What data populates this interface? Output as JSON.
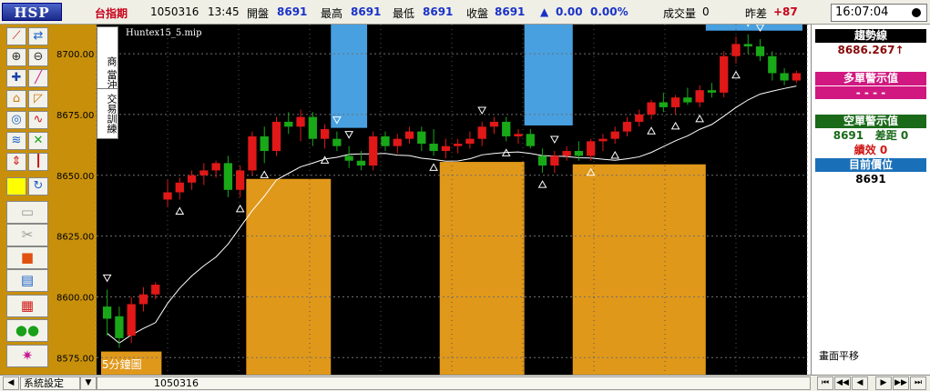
{
  "topbar": {
    "logo": "HSP",
    "symbol": "台指期",
    "date": "1050316",
    "time": "13:45",
    "open_label": "開盤",
    "open_value": "8691",
    "high_label": "最高",
    "high_value": "8691",
    "low_label": "最低",
    "low_value": "8691",
    "close_label": "收盤",
    "close_value": "8691",
    "change_arrow": "▲",
    "change_value": "0.00",
    "change_pct": "0.00%",
    "volume_label": "成交量",
    "volume_value": "0",
    "diff_label": "昨差",
    "diff_value": "+87",
    "clock": "16:07:04"
  },
  "chart": {
    "study_name": "Huntex15_5.mip",
    "vertical_label_1": "商",
    "vertical_label_2": "當沖狙擊",
    "vertical_label_3": "交易訓練",
    "interval_label": "5分鐘圖",
    "y_tick_labels": [
      "8700.00",
      "8675.00",
      "8650.00",
      "8625.00",
      "8600.00",
      "8575.00"
    ],
    "colors": {
      "up": "#e01818",
      "down": "#18a818",
      "fill_orange": "#e0981a",
      "fill_blue": "#48a0e0",
      "background": "#000000",
      "ma_line": "#ffffff"
    }
  },
  "chart_data": {
    "type": "candlestick",
    "ylim": [
      8568,
      8712
    ],
    "y_ticks": [
      8700,
      8675,
      8650,
      8625,
      8600,
      8575
    ],
    "candles": [
      {
        "o": 8596,
        "h": 8603,
        "l": 8584,
        "c": 8591
      },
      {
        "o": 8592,
        "h": 8596,
        "l": 8579,
        "c": 8583
      },
      {
        "o": 8584,
        "h": 8600,
        "l": 8581,
        "c": 8597
      },
      {
        "o": 8597,
        "h": 8604,
        "l": 8594,
        "c": 8601
      },
      {
        "o": 8601,
        "h": 8606,
        "l": 8599,
        "c": 8605
      },
      {
        "o": 8640,
        "h": 8648,
        "l": 8637,
        "c": 8643
      },
      {
        "o": 8643,
        "h": 8649,
        "l": 8640,
        "c": 8647
      },
      {
        "o": 8647,
        "h": 8652,
        "l": 8644,
        "c": 8650
      },
      {
        "o": 8650,
        "h": 8655,
        "l": 8646,
        "c": 8652
      },
      {
        "o": 8652,
        "h": 8656,
        "l": 8649,
        "c": 8655
      },
      {
        "o": 8655,
        "h": 8658,
        "l": 8641,
        "c": 8644
      },
      {
        "o": 8644,
        "h": 8654,
        "l": 8641,
        "c": 8652
      },
      {
        "o": 8652,
        "h": 8668,
        "l": 8650,
        "c": 8666
      },
      {
        "o": 8666,
        "h": 8670,
        "l": 8655,
        "c": 8660
      },
      {
        "o": 8660,
        "h": 8674,
        "l": 8658,
        "c": 8672
      },
      {
        "o": 8672,
        "h": 8676,
        "l": 8667,
        "c": 8670
      },
      {
        "o": 8670,
        "h": 8677,
        "l": 8664,
        "c": 8674
      },
      {
        "o": 8674,
        "h": 8676,
        "l": 8662,
        "c": 8665
      },
      {
        "o": 8665,
        "h": 8671,
        "l": 8661,
        "c": 8669
      },
      {
        "o": 8665,
        "h": 8668,
        "l": 8660,
        "c": 8662
      },
      {
        "o": 8658,
        "h": 8662,
        "l": 8653,
        "c": 8656
      },
      {
        "o": 8656,
        "h": 8660,
        "l": 8652,
        "c": 8654
      },
      {
        "o": 8654,
        "h": 8668,
        "l": 8652,
        "c": 8666
      },
      {
        "o": 8666,
        "h": 8668,
        "l": 8660,
        "c": 8662
      },
      {
        "o": 8662,
        "h": 8667,
        "l": 8659,
        "c": 8665
      },
      {
        "o": 8665,
        "h": 8670,
        "l": 8663,
        "c": 8668
      },
      {
        "o": 8668,
        "h": 8670,
        "l": 8660,
        "c": 8663
      },
      {
        "o": 8663,
        "h": 8669,
        "l": 8658,
        "c": 8660
      },
      {
        "o": 8660,
        "h": 8665,
        "l": 8657,
        "c": 8662
      },
      {
        "o": 8662,
        "h": 8665,
        "l": 8659,
        "c": 8663
      },
      {
        "o": 8663,
        "h": 8668,
        "l": 8661,
        "c": 8665
      },
      {
        "o": 8665,
        "h": 8672,
        "l": 8662,
        "c": 8670
      },
      {
        "o": 8670,
        "h": 8674,
        "l": 8667,
        "c": 8672
      },
      {
        "o": 8672,
        "h": 8674,
        "l": 8664,
        "c": 8666
      },
      {
        "o": 8666,
        "h": 8669,
        "l": 8663,
        "c": 8667
      },
      {
        "o": 8667,
        "h": 8669,
        "l": 8661,
        "c": 8662
      },
      {
        "o": 8658,
        "h": 8661,
        "l": 8651,
        "c": 8654
      },
      {
        "o": 8654,
        "h": 8660,
        "l": 8651,
        "c": 8658
      },
      {
        "o": 8658,
        "h": 8662,
        "l": 8656,
        "c": 8660
      },
      {
        "o": 8660,
        "h": 8664,
        "l": 8656,
        "c": 8658
      },
      {
        "o": 8658,
        "h": 8665,
        "l": 8656,
        "c": 8664
      },
      {
        "o": 8664,
        "h": 8667,
        "l": 8660,
        "c": 8665
      },
      {
        "o": 8665,
        "h": 8670,
        "l": 8663,
        "c": 8668
      },
      {
        "o": 8668,
        "h": 8674,
        "l": 8666,
        "c": 8672
      },
      {
        "o": 8672,
        "h": 8677,
        "l": 8670,
        "c": 8675
      },
      {
        "o": 8675,
        "h": 8681,
        "l": 8673,
        "c": 8680
      },
      {
        "o": 8680,
        "h": 8684,
        "l": 8676,
        "c": 8678
      },
      {
        "o": 8678,
        "h": 8683,
        "l": 8675,
        "c": 8682
      },
      {
        "o": 8682,
        "h": 8686,
        "l": 8679,
        "c": 8680
      },
      {
        "o": 8680,
        "h": 8687,
        "l": 8678,
        "c": 8685
      },
      {
        "o": 8685,
        "h": 8688,
        "l": 8682,
        "c": 8684
      },
      {
        "o": 8684,
        "h": 8701,
        "l": 8682,
        "c": 8699
      },
      {
        "o": 8699,
        "h": 8707,
        "l": 8696,
        "c": 8704
      },
      {
        "o": 8704,
        "h": 8708,
        "l": 8700,
        "c": 8703
      },
      {
        "o": 8703,
        "h": 8706,
        "l": 8697,
        "c": 8699
      },
      {
        "o": 8699,
        "h": 8701,
        "l": 8689,
        "c": 8692
      },
      {
        "o": 8692,
        "h": 8694,
        "l": 8687,
        "c": 8689
      },
      {
        "o": 8689,
        "h": 8693,
        "l": 8688,
        "c": 8692
      }
    ]
  },
  "right_panel": {
    "trend_label": "趨勢線",
    "trend_value": "8686.267↑",
    "long_label": "多單警示值",
    "long_value": "- - - -",
    "short_label": "空單警示值",
    "short_value": "8691",
    "short_diff_label": "差距",
    "short_diff_value": "0",
    "perf_label": "績效",
    "perf_value": "0",
    "position_label": "目前價位",
    "position_value": "8691",
    "footer_text": "畫面平移",
    "colors": {
      "trend_bg": "#000000",
      "long_bg": "#d01880",
      "short_bg": "#1a6a1a",
      "position_bg": "#1a70b8"
    }
  },
  "statusbar": {
    "left_arrow": "◀",
    "system_setting": "系統設定",
    "dropdown_arrow": "▼",
    "date_label": "1050316"
  },
  "toolbar": {
    "icons": [
      "trend-line-icon",
      "magnet-icon",
      "zoom-in-icon",
      "zoom-out-icon",
      "crosshair-icon",
      "pen-icon",
      "unlock-icon",
      "ruler-icon",
      "compass-icon",
      "curve-icon",
      "fib-icon",
      "wave-icon",
      "arrow-icon",
      "bar-icon",
      "color-icon",
      "refresh-icon",
      "folder-icon",
      "scissors-icon",
      "stop-icon",
      "export-icon",
      "grid-icon",
      "people-icon",
      "alert-icon"
    ]
  }
}
